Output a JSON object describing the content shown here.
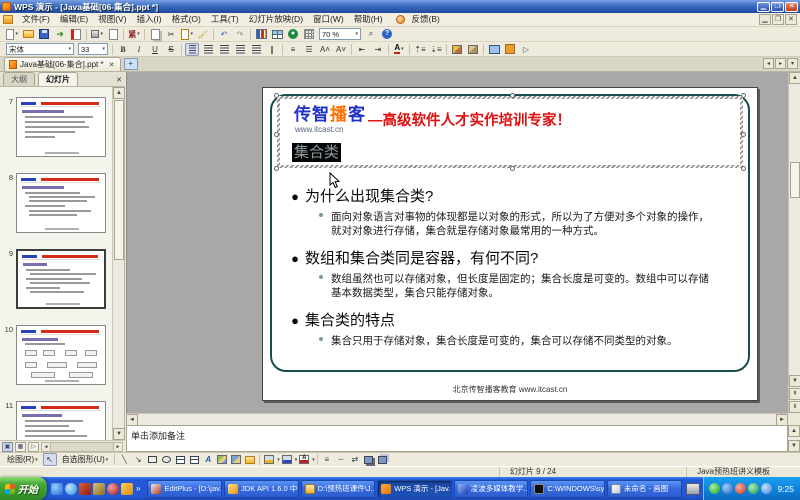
{
  "titlebar": {
    "title": "WPS 演示 - [Java基础[06-集合].ppt *]"
  },
  "menubar": {
    "items": [
      "文件(F)",
      "编辑(E)",
      "视图(V)",
      "插入(I)",
      "格式(O)",
      "工具(T)",
      "幻灯片放映(D)",
      "窗口(W)",
      "帮助(H)"
    ],
    "feedback": "反馈(B)"
  },
  "toolbar": {
    "zoom": "70 %"
  },
  "fontbar": {
    "font": "宋体",
    "size": "33",
    "bold": "B",
    "italic": "I",
    "underline": "U",
    "strike": "S",
    "font_color": "A"
  },
  "tabbar": {
    "doc_tab": "Java基础[06-集合].ppt *"
  },
  "sidebar": {
    "outline_tab": "大纲",
    "slides_tab": "幻灯片",
    "thumbnails": [
      {
        "number": "7"
      },
      {
        "number": "8"
      },
      {
        "number": "9"
      },
      {
        "number": "10"
      },
      {
        "number": "11"
      }
    ]
  },
  "slide": {
    "logo_part1": "传智",
    "logo_part2": "播",
    "logo_part3": "客",
    "logo_url": "www.itcast.cn",
    "slogan": "—高级软件人才实作培训专家！",
    "title": "集合类",
    "bullets": [
      {
        "heading": "为什么出现集合类?",
        "detail": "面向对象语言对事物的体现都是以对象的形式，所以为了方便对多个对象的操作，就对对象进行存储，集合就是存储对象最常用的一种方式。"
      },
      {
        "heading": "数组和集合类同是容器，有何不同?",
        "detail": "数组虽然也可以存储对象，但长度是固定的；集合长度是可变的。数组中可以存储基本数据类型，集合只能存储对象。"
      },
      {
        "heading": "集合类的特点",
        "detail": "集合只用于存储对象，集合长度是可变的，集合可以存储不同类型的对象。"
      }
    ],
    "footer": "北京传智播客教育 www.itcast.cn"
  },
  "notes": {
    "placeholder": "单击添加备注"
  },
  "drawbar": {
    "draw": "绘图(R)",
    "autoshapes": "自选图形(U)",
    "font_color": "A"
  },
  "statusbar": {
    "slide_position": "幻灯片 9 / 24",
    "template": "Java预热班讲义模板"
  },
  "taskbar": {
    "start": "开始",
    "windows": [
      {
        "label": "EditPlus - [D:\\jav..."
      },
      {
        "label": "JDK API 1.6.0 中..."
      },
      {
        "label": "D:\\预热班课件\\J..."
      },
      {
        "label": "WPS 演示 - [Jav..."
      },
      {
        "label": "凌波多媒体教学..."
      },
      {
        "label": "C:\\WINDOWS\\sy..."
      },
      {
        "label": "未命名 - 画图"
      }
    ],
    "time": "9:25"
  },
  "colors": {
    "logo_blue": "#2030c8",
    "logo_orange": "#ff7000",
    "slogan_red": "#e01010",
    "taskbar_blue": "#2258d8",
    "start_green": "#48a838"
  }
}
